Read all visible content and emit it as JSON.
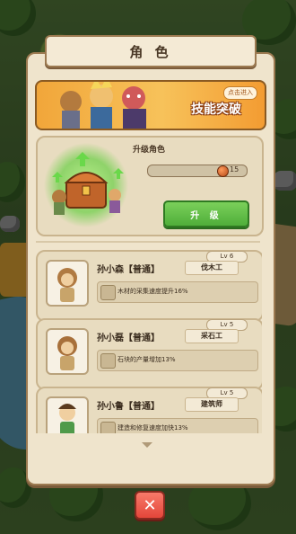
{
  "title": "角 色",
  "banner": {
    "skill_text": "技能突破",
    "enter_chip": "点击进入"
  },
  "upgrade": {
    "title": "升级角色",
    "progress": 0.0,
    "cost": "15",
    "button_label": "升 级"
  },
  "characters": [
    {
      "level": "Lv 6",
      "name": "孙小森【普通】",
      "job": "伐木工",
      "effect": "木材的采集速度提升16%",
      "effect_icon": "wood-icon"
    },
    {
      "level": "Lv 5",
      "name": "孙小磊【普通】",
      "job": "采石工",
      "effect": "石块的产量增加13%",
      "effect_icon": "stone-icon"
    },
    {
      "level": "Lv 5",
      "name": "孙小鲁【普通】",
      "job": "建筑师",
      "effect": "建造和修复速度加快13%",
      "effect_icon": "hammer-icon"
    }
  ],
  "close_icon": "close-icon",
  "colors": {
    "panel": "#efe4cc",
    "border": "#9c7a51",
    "upgrade_button": "#5cbd45",
    "close_button": "#e4463a",
    "banner": "#f3a83a"
  }
}
